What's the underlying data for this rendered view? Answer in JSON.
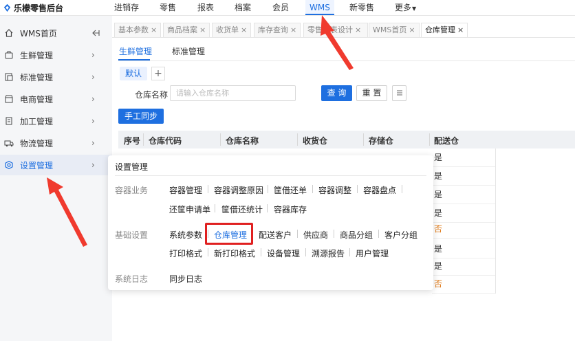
{
  "header": {
    "logo_text": "乐檬零售后台",
    "nav": [
      {
        "label": "进销存"
      },
      {
        "label": "零售"
      },
      {
        "label": "报表"
      },
      {
        "label": "档案"
      },
      {
        "label": "会员"
      },
      {
        "label": "WMS"
      },
      {
        "label": "新零售"
      },
      {
        "label": "更多"
      }
    ],
    "active_nav": "WMS",
    "accent": "#1e6fe0"
  },
  "sidebar": {
    "items": [
      {
        "label": "WMS首页",
        "icon": "home-icon"
      },
      {
        "label": "生鲜管理",
        "icon": "fresh-icon"
      },
      {
        "label": "标准管理",
        "icon": "standard-icon"
      },
      {
        "label": "电商管理",
        "icon": "shop-icon"
      },
      {
        "label": "加工管理",
        "icon": "process-icon"
      },
      {
        "label": "物流管理",
        "icon": "truck-icon"
      },
      {
        "label": "设置管理",
        "icon": "settings-icon"
      }
    ],
    "active": "设置管理",
    "collapse_icon": "collapse-icon"
  },
  "tabs": [
    {
      "label": "基本参数"
    },
    {
      "label": "商品档案"
    },
    {
      "label": "收货单"
    },
    {
      "label": "库存查询"
    },
    {
      "label": "零售报表设计"
    },
    {
      "label": "WMS首页"
    },
    {
      "label": "仓库管理"
    }
  ],
  "active_tab": "仓库管理",
  "subtabs": [
    {
      "label": "生鲜管理"
    },
    {
      "label": "标准管理"
    }
  ],
  "chip": {
    "label": "默认",
    "add": "+"
  },
  "filter": {
    "label": "仓库名称",
    "placeholder": "请输入仓库名称"
  },
  "buttons": {
    "query": "查 询",
    "reset": "重 置",
    "sync": "手工同步"
  },
  "table": {
    "headers": [
      "序号",
      "仓库代码",
      "仓库名称",
      "收货仓",
      "存储仓",
      "配送仓"
    ],
    "distribution_values": [
      "是",
      "是",
      "是",
      "是",
      "否",
      "是",
      "是",
      "否"
    ],
    "no_color": "#e07b1a"
  },
  "popup": {
    "title": "设置管理",
    "groups": [
      {
        "name": "容器业务",
        "links": [
          "容器管理",
          "容器调整原因",
          "筐借还单",
          "容器调整",
          "容器盘点",
          "还筐申请单",
          "筐借还统计",
          "容器库存"
        ]
      },
      {
        "name": "基础设置",
        "links": [
          "系统参数",
          "仓库管理",
          "配送客户",
          "供应商",
          "商品分组",
          "客户分组",
          "打印格式",
          "新打印格式",
          "设备管理",
          "溯源报告",
          "用户管理"
        ]
      },
      {
        "name": "系统日志",
        "links": [
          "同步日志"
        ]
      }
    ],
    "selected": "仓库管理",
    "highlight_color": "#e02020"
  }
}
